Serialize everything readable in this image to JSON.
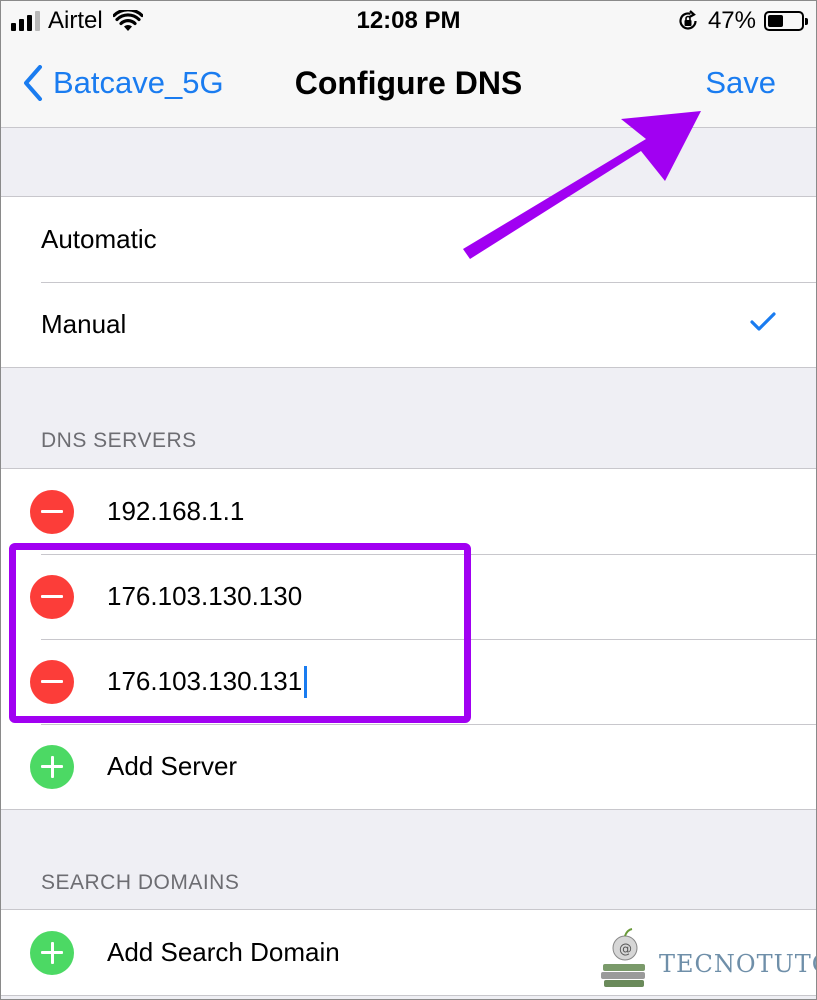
{
  "status_bar": {
    "carrier": "Airtel",
    "time": "12:08 PM",
    "battery_percent": "47%",
    "battery_level": 0.47,
    "signal_bars_filled": 3,
    "signal_bars_total": 4
  },
  "nav": {
    "back_label": "Batcave_5G",
    "title": "Configure DNS",
    "save_label": "Save"
  },
  "modes": {
    "items": [
      {
        "label": "Automatic",
        "selected": false
      },
      {
        "label": "Manual",
        "selected": true
      }
    ]
  },
  "dns_servers": {
    "header": "DNS SERVERS",
    "servers": [
      "192.168.1.1",
      "176.103.130.130",
      "176.103.130.131"
    ],
    "add_label": "Add Server"
  },
  "search_domains": {
    "header": "SEARCH DOMAINS",
    "add_label": "Add Search Domain"
  },
  "watermark": {
    "text": "TECNOTUTO"
  },
  "colors": {
    "accent": "#1a7cf0",
    "delete": "#fc3d39",
    "add": "#4cd964",
    "annotation": "#a100f2"
  },
  "icons": {
    "back": "chevron-left-icon",
    "check": "checkmark-icon",
    "delete": "minus-circle-icon",
    "add": "plus-circle-icon",
    "wifi": "wifi-icon",
    "rotation_lock": "rotation-lock-icon",
    "battery": "battery-icon"
  }
}
